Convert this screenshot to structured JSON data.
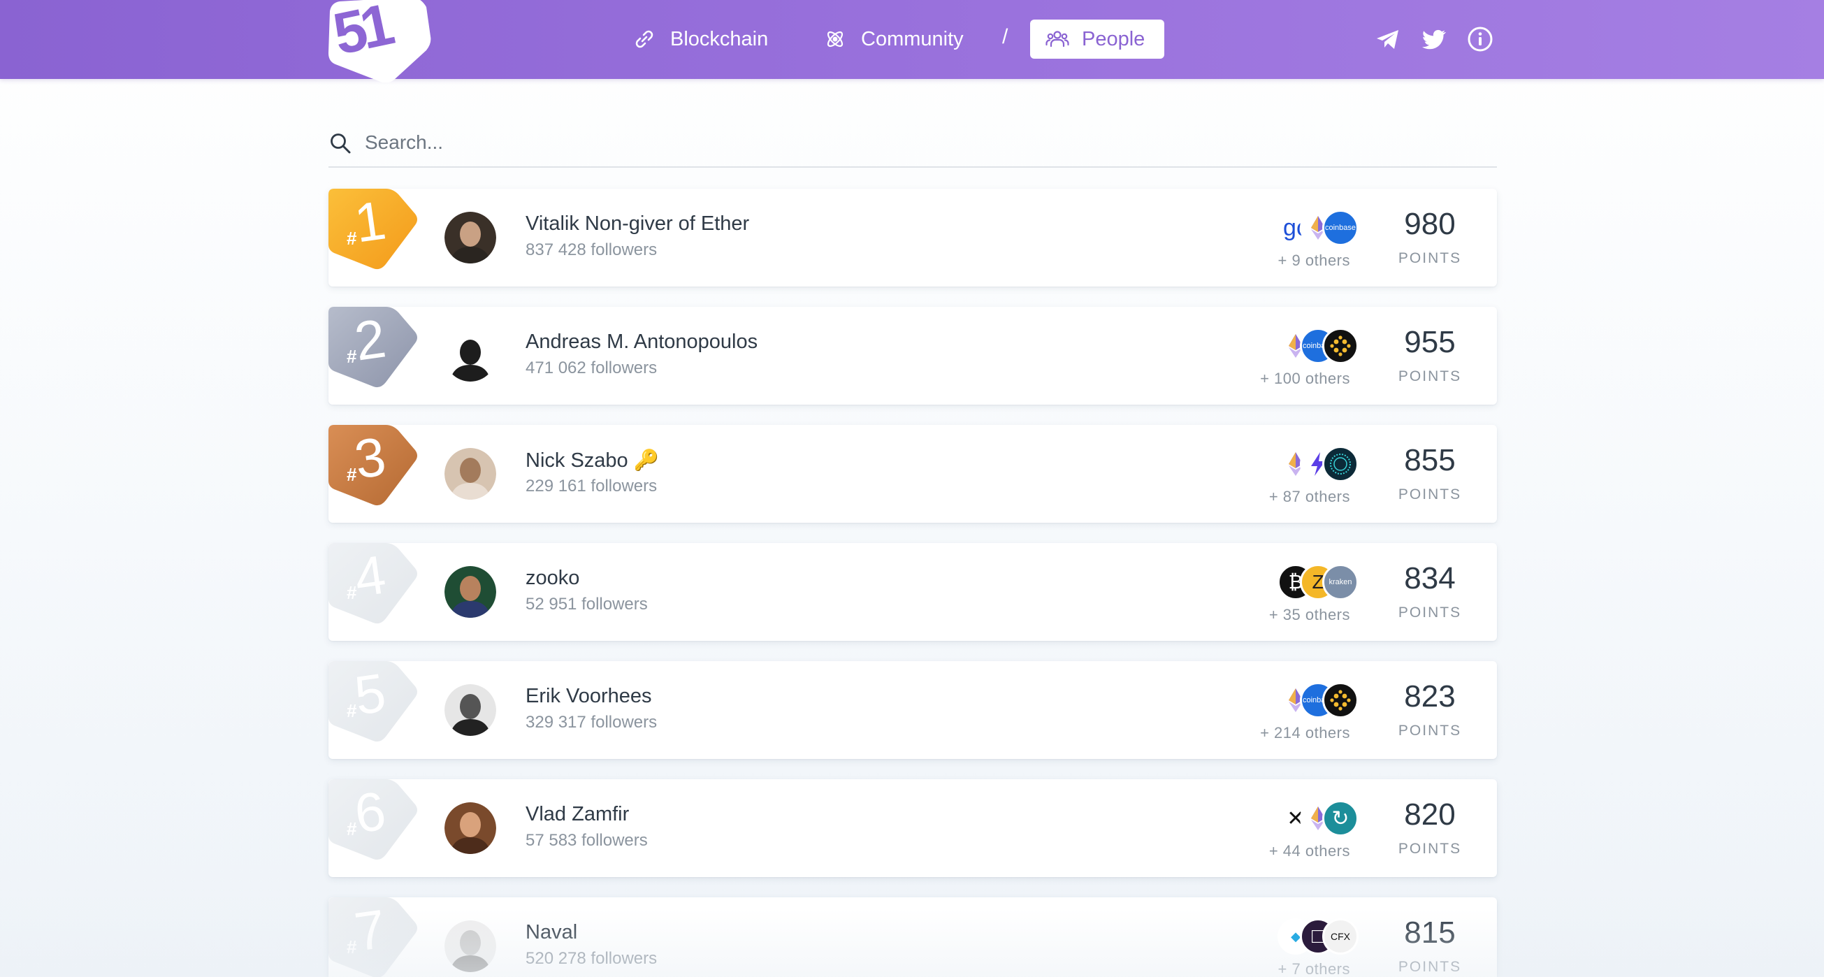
{
  "header": {
    "logo": "51",
    "nav": {
      "blockchain": "Blockchain",
      "community": "Community",
      "separator": "/",
      "people": "People"
    },
    "social_icons": [
      "telegram-icon",
      "twitter-icon",
      "info-icon"
    ],
    "accent": "#8a63d2"
  },
  "search": {
    "placeholder": "Search...",
    "value": ""
  },
  "people": [
    {
      "rank": "1",
      "name": "Vitalik Non-giver of Ether",
      "followers": "837 428 followers",
      "tokens": [
        "golem",
        "ethereum",
        "coinbase"
      ],
      "others": "+ 9 others",
      "points": "980",
      "points_label": "POINTS",
      "medal": "gold"
    },
    {
      "rank": "2",
      "name": "Andreas M. Antonopoulos",
      "followers": "471 062 followers",
      "tokens": [
        "ethereum",
        "coinbase",
        "binance"
      ],
      "others": "+ 100 others",
      "points": "955",
      "points_label": "POINTS",
      "medal": "silver"
    },
    {
      "rank": "3",
      "name": "Nick Szabo 🔑",
      "followers": "229 161 followers",
      "tokens": [
        "ethereum",
        "lightning",
        "celo"
      ],
      "others": "+ 87 others",
      "points": "855",
      "points_label": "POINTS",
      "medal": "bronze"
    },
    {
      "rank": "4",
      "name": "zooko",
      "followers": "52 951 followers",
      "tokens": [
        "bitcoin",
        "zcash",
        "kraken"
      ],
      "others": "+ 35 others",
      "points": "834",
      "points_label": "POINTS",
      "medal": "plain"
    },
    {
      "rank": "5",
      "name": "Erik Voorhees",
      "followers": "329 317 followers",
      "tokens": [
        "ethereum",
        "coinbase",
        "binance"
      ],
      "others": "+ 214 others",
      "points": "823",
      "points_label": "POINTS",
      "medal": "plain"
    },
    {
      "rank": "6",
      "name": "Vlad Zamfir",
      "followers": "57 583 followers",
      "tokens": [
        "casper",
        "ethereum",
        "cosmos"
      ],
      "others": "+ 44 others",
      "points": "820",
      "points_label": "POINTS",
      "medal": "plain"
    },
    {
      "rank": "7",
      "name": "Naval",
      "followers": "520 278 followers",
      "tokens": [
        "dfinity",
        "polkadot",
        "conflux"
      ],
      "others": "+ 7 others",
      "points": "815",
      "points_label": "POINTS",
      "medal": "plain"
    }
  ],
  "token_labels": {
    "coinbase": "coinbase",
    "kraken": "kraken",
    "conflux": "CFX"
  },
  "colors": {
    "gold": [
      "#fbbf3a",
      "#f39a1a"
    ],
    "silver": [
      "#b6bccb",
      "#8d94aa"
    ],
    "bronze": [
      "#d98e55",
      "#b56a33"
    ],
    "plain": [
      "#eef1f4",
      "#e3e7eb"
    ]
  }
}
